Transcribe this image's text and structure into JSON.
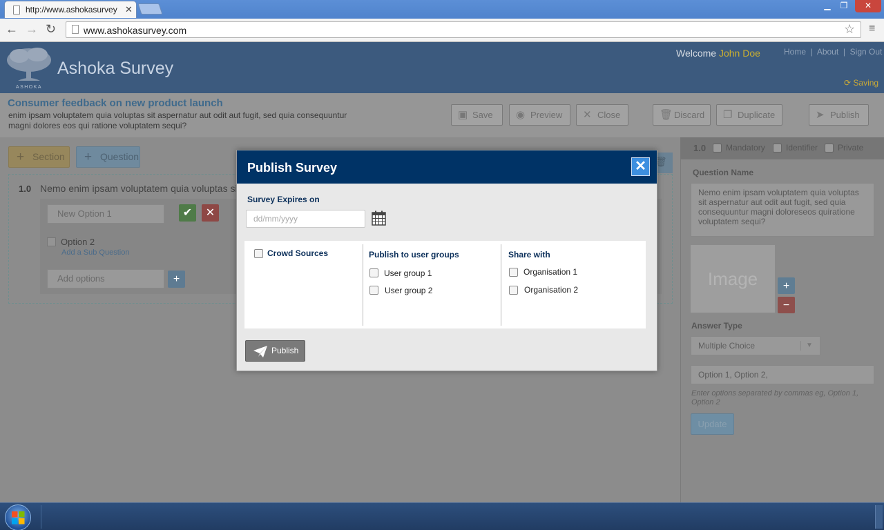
{
  "browser": {
    "tab_title": "http://www.ashokasurvey",
    "tab_close": "✕",
    "url": "www.ashokasurvey.com",
    "window_controls": [
      "▁",
      "❐",
      "✕"
    ]
  },
  "header": {
    "logo_text": "ASHOKA",
    "app_name": "Ashoka Survey",
    "welcome_prefix": "Welcome",
    "user_name": "John Doe",
    "links": [
      "Home",
      "About",
      "Sign Out"
    ],
    "saving": "Saving"
  },
  "survey": {
    "title": "Consumer feedback on new product launch",
    "description": "enim ipsam voluptatem quia voluptas sit aspernatur aut odit aut fugit, sed quia consequuntur magni dolores eos qui ratione voluptatem sequi?",
    "toolbar": {
      "save": "Save",
      "preview": "Preview",
      "close": "Close",
      "discard": "Discard",
      "duplicate": "Duplicate",
      "publish": "Publish"
    }
  },
  "editor": {
    "add_section": "Section",
    "add_question": "Question",
    "question_number": "1.0",
    "question_text": "Nemo enim ipsam voluptatem quia voluptas sit",
    "new_option_placeholder": "New Option 1",
    "option_2": "Option 2",
    "add_sub_question": "Add a Sub Question",
    "add_options_placeholder": "Add options"
  },
  "right_panel": {
    "number": "1.0",
    "mandatory": "Mandatory",
    "identifier": "Identifier",
    "private": "Private",
    "question_name_label": "Question Name",
    "question_name_value": "Nemo enim ipsam voluptatem quia voluptas sit aspernatur aut odit aut fugit, sed quia consequuntur magni doloreseos quiratione voluptatem sequi?",
    "image_placeholder": "Image",
    "answer_type_label": "Answer Type",
    "answer_type_value": "Multiple Choice",
    "options_value": "Option 1, Option 2,",
    "options_hint": "Enter options separated by commas eg, Option 1, Option 2",
    "update": "Update"
  },
  "modal": {
    "title": "Publish Survey",
    "close": "✕",
    "expires_label": "Survey Expires on",
    "date_placeholder": "dd/mm/yyyy",
    "crowd_sources": "Crowd Sources",
    "user_groups_heading": "Publish to user groups",
    "user_groups": [
      "User group 1",
      "User group 2"
    ],
    "share_heading": "Share with",
    "organisations": [
      "Organisation 1",
      "Organisation 2"
    ],
    "publish_button": "Publish"
  },
  "colors": {
    "modal_header": "#003366",
    "close_button": "#3d8fe0",
    "link_highlight": "#ccb030"
  }
}
